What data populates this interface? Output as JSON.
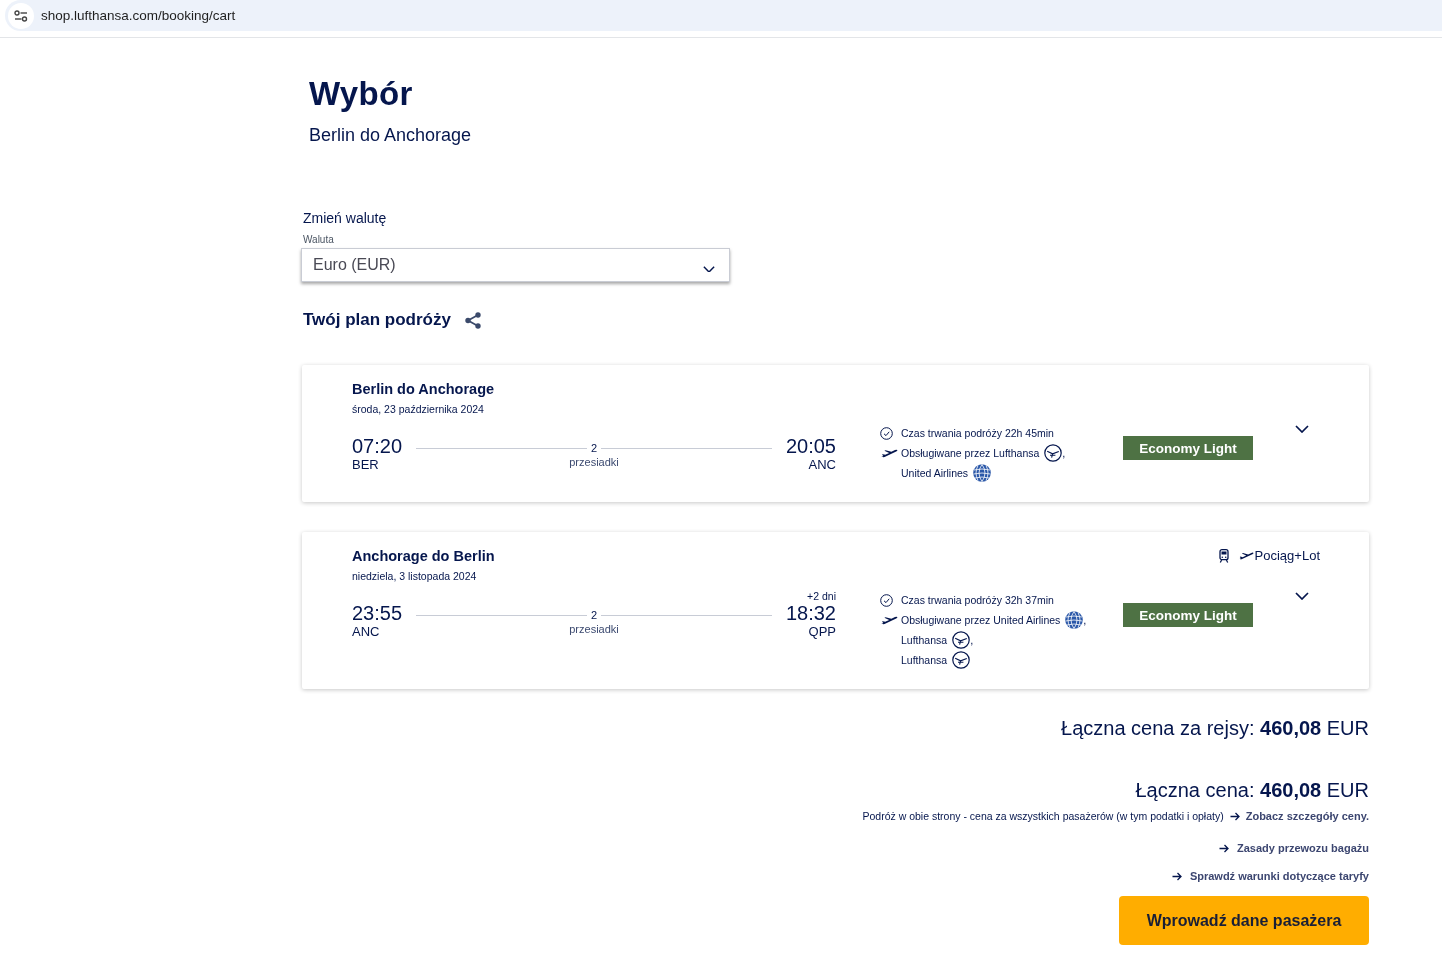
{
  "browser": {
    "url": "shop.lufthansa.com/booking/cart"
  },
  "header": {
    "title": "Wybór",
    "subtitle": "Berlin do Anchorage"
  },
  "currency": {
    "heading": "Zmień walutę",
    "label": "Waluta",
    "value": "Euro (EUR)"
  },
  "itinerary": {
    "title": "Twój plan podróży",
    "flights": [
      {
        "title": "Berlin do Anchorage",
        "date": "środa, 23 października 2024",
        "departure": {
          "time": "07:20",
          "airport": "BER"
        },
        "stops": {
          "count": "2",
          "label": "przesiadki"
        },
        "arrival": {
          "time": "20:05",
          "airport": "ANC"
        },
        "duration": "Czas trwania podróży 22h 45min",
        "operators": [
          {
            "text": "Obsługiwane przez Lufthansa",
            "kind": "crane",
            "suffix": ","
          },
          {
            "text": "United Airlines",
            "kind": "globe"
          }
        ],
        "fare": "Economy Light",
        "expanded": false
      },
      {
        "title": "Anchorage do Berlin",
        "date": "niedziela, 3 listopada 2024",
        "tag": {
          "label": "Pociąg+Lot"
        },
        "departure": {
          "time": "23:55",
          "airport": "ANC"
        },
        "stops": {
          "count": "2",
          "label": "przesiadki"
        },
        "arrival": {
          "day_offset": "+2 dni",
          "time": "18:32",
          "airport": "QPP"
        },
        "duration": "Czas trwania podróży 32h 37min",
        "operators": [
          {
            "text": "Obsługiwane przez United Airlines",
            "kind": "globe",
            "suffix": ","
          },
          {
            "text": "Lufthansa",
            "kind": "crane",
            "suffix": ","
          },
          {
            "text": "Lufthansa",
            "kind": "crane"
          }
        ],
        "fare": "Economy Light",
        "expanded": false
      }
    ]
  },
  "summary": {
    "flights_total": "Łączna cena za rejsy: **460,08** EUR",
    "total": "Łączna cena: **460,08** EUR",
    "note": {
      "text": "Podróż w obie strony - cena za wszystkich pasażerów (w tym podatki i opłaty)",
      "link": "Zobacz szczegóły ceny."
    },
    "links": [
      "Zasady przewozu bagażu",
      "Sprawdź warunki dotyczące taryfy"
    ],
    "button": "Wprowadź dane pasażera"
  }
}
